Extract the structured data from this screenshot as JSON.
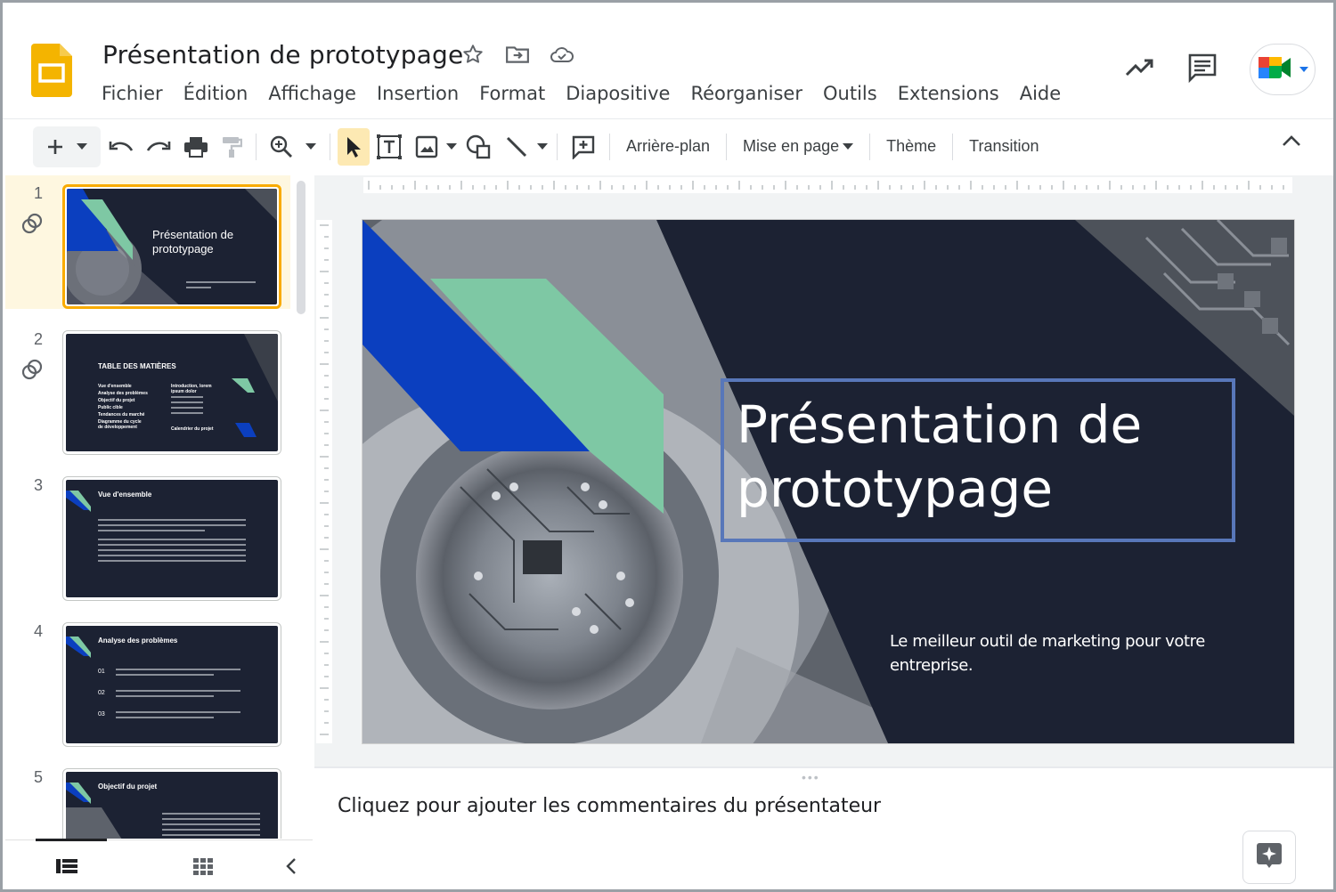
{
  "app": {
    "doc_title": "Présentation de prototypage",
    "title_icons": [
      "star-icon",
      "move-to-folder-icon",
      "cloud-saved-icon"
    ]
  },
  "menu": [
    "Fichier",
    "Édition",
    "Affichage",
    "Insertion",
    "Format",
    "Diapositive",
    "Réorganiser",
    "Outils",
    "Extensions",
    "Aide"
  ],
  "header_actions": [
    "activity-trend-icon",
    "comments-icon",
    "meet-icon"
  ],
  "toolbar": {
    "icons": [
      "plus-icon",
      "undo-icon",
      "redo-icon",
      "print-icon",
      "paint-format-icon",
      "zoom-icon",
      "select-cursor-icon",
      "text-box-icon",
      "image-icon",
      "shape-icon",
      "line-icon",
      "add-comment-icon"
    ],
    "background_label": "Arrière-plan",
    "layout_label": "Mise en page",
    "theme_label": "Thème",
    "transition_label": "Transition"
  },
  "filmstrip": {
    "slides": [
      {
        "number": "1",
        "title": "Présentation de prototypage"
      },
      {
        "number": "2",
        "title": "TABLE DES MATIÈRES",
        "items_left": [
          "Vue d'ensemble",
          "Analyse des problèmes",
          "Objectif du projet",
          "Public cible",
          "Tendances du marché",
          "Diagramme du cycle de développement"
        ],
        "items_right": [
          "Introduction, lorem ipsum dolor",
          "Calendrier du projet"
        ]
      },
      {
        "number": "3",
        "title": "Vue d'ensemble"
      },
      {
        "number": "4",
        "title": "Analyse des problèmes",
        "points": [
          "01",
          "02",
          "03"
        ]
      },
      {
        "number": "5",
        "title": "Objectif du projet"
      }
    ]
  },
  "slide": {
    "title": "Présentation de prototypage",
    "subtitle": "Le meilleur outil de marketing pour votre entreprise.",
    "colors": {
      "background": "#1c2233",
      "blue": "#0b3fbf",
      "green": "#7ec8a4",
      "frame": "#5877b9"
    }
  },
  "notes": {
    "placeholder": "Cliquez pour ajouter les commentaires du présentateur"
  },
  "footer_icons": [
    "filmstrip-view-icon",
    "grid-view-icon",
    "collapse-panel-icon"
  ]
}
